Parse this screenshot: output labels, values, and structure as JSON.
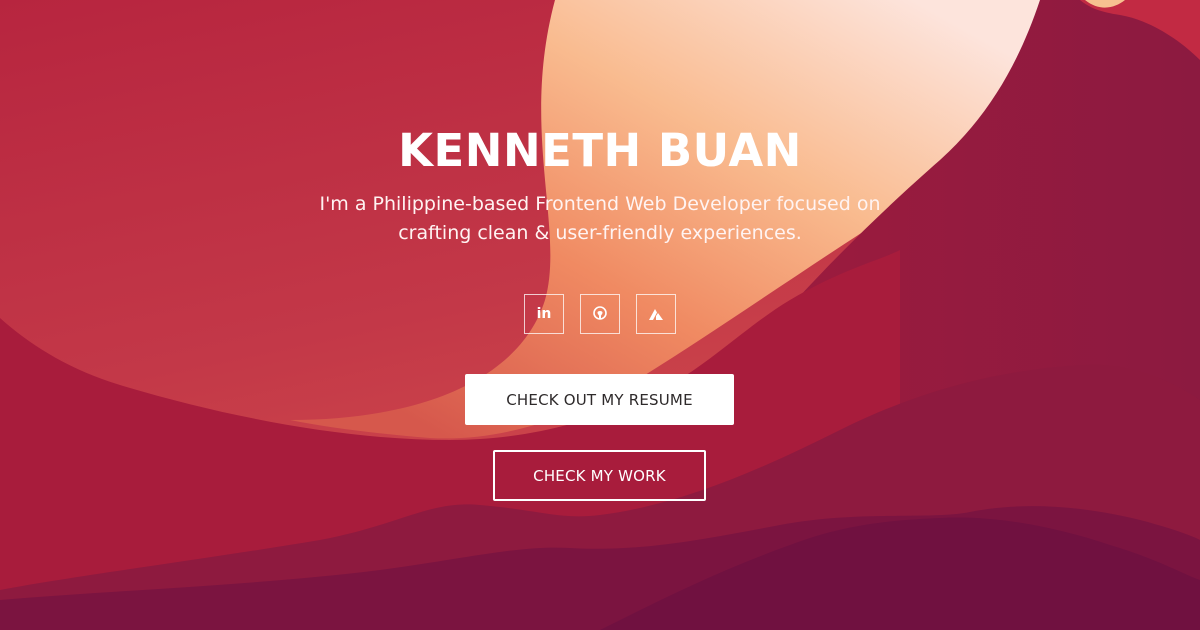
{
  "hero": {
    "name": "KENNETH BUAN",
    "tagline": "I'm a Philippine-based Frontend Web Developer focused on crafting clean & user-friendly experiences."
  },
  "socials": [
    {
      "icon": "linkedin-icon",
      "glyph": "in"
    },
    {
      "icon": "github-icon"
    },
    {
      "icon": "codepen-icon"
    }
  ],
  "buttons": {
    "resume_label": "CHECK OUT MY RESUME",
    "work_label": "CHECK MY WORK"
  },
  "colors": {
    "background_top": "#b5263f",
    "sun_light": "#fde1d9",
    "sun_warm": "#f9b487",
    "mountain_mid": "#a01d3f",
    "mountain_dark": "#7a1540",
    "button_bg": "#ffffff",
    "button_text": "#2e2a2b"
  }
}
